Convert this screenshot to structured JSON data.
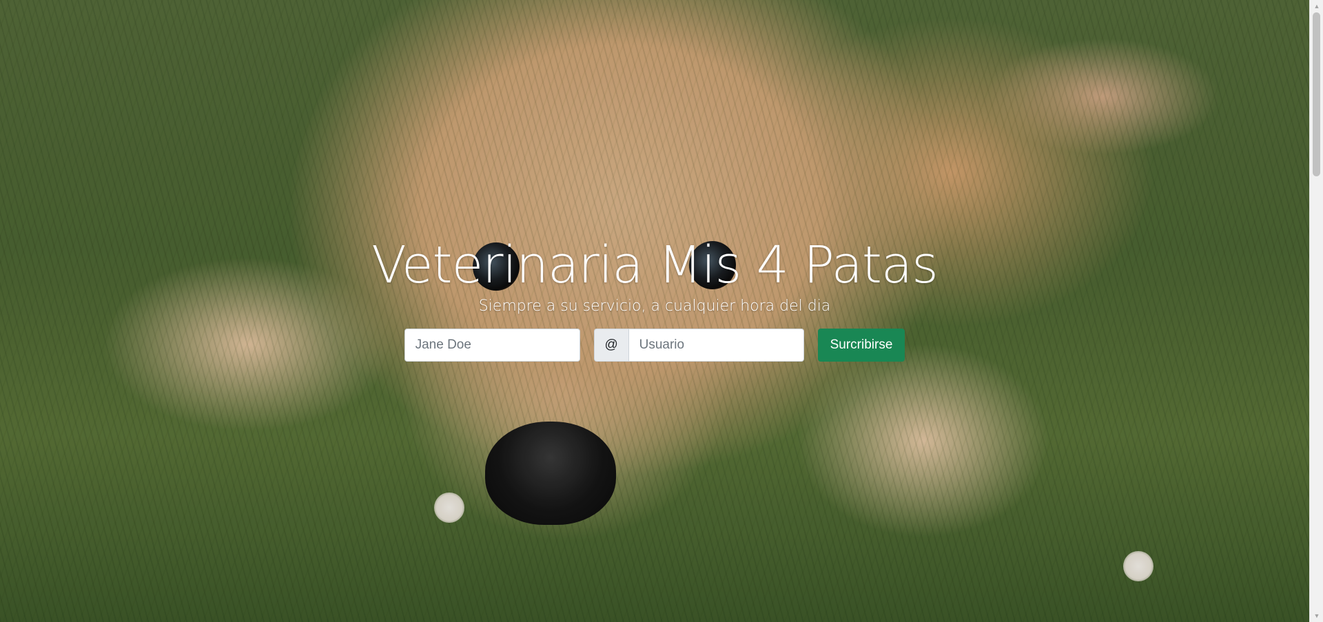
{
  "hero": {
    "title": "Veterinaria Mis 4 Patas",
    "subtitle": "Siempre a su servicio, a cualquier hora del dia",
    "background_image": "puppy lying on grass"
  },
  "form": {
    "name_placeholder": "Jane Doe",
    "at_symbol": "@",
    "username_placeholder": "Usuario",
    "submit_label": "Surcribirse"
  },
  "colors": {
    "button": "#198754",
    "text": "#ffffff"
  },
  "icons": {
    "scroll_up": "chevron-up-icon",
    "scroll_down": "chevron-down-icon"
  }
}
